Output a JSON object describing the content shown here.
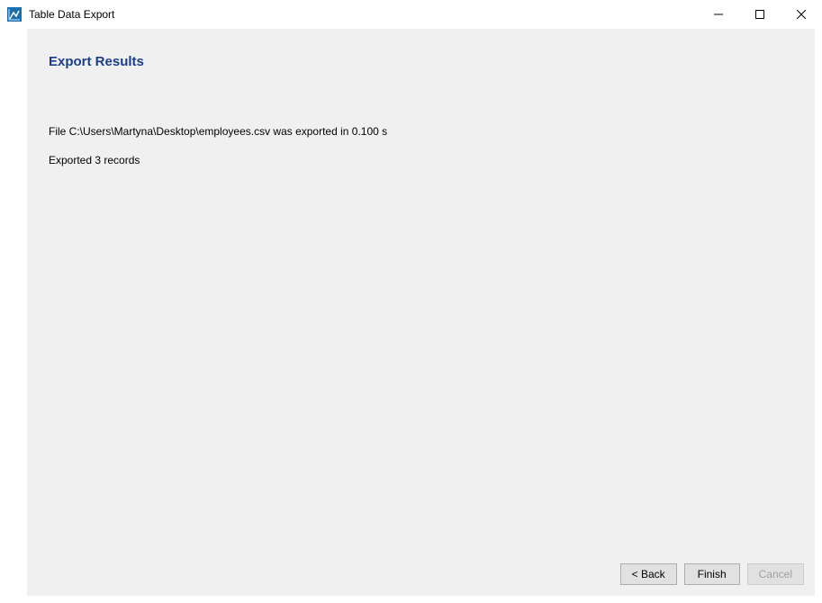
{
  "window": {
    "title": "Table Data Export"
  },
  "content": {
    "heading": "Export Results",
    "line1": "File C:\\Users\\Martyna\\Desktop\\employees.csv was exported in 0.100 s",
    "line2": "Exported 3 records"
  },
  "buttons": {
    "back": "< Back",
    "finish": "Finish",
    "cancel": "Cancel"
  }
}
